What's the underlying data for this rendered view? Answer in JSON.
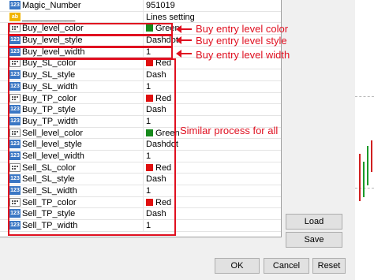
{
  "rows": [
    {
      "icon": "num",
      "name": "Magic_Number",
      "value": "951019"
    },
    {
      "icon": "ab",
      "name": "___________",
      "value": "Lines setting"
    },
    {
      "icon": "col",
      "name": "Buy_level_color",
      "value": "Green",
      "swatch": "#178a1c"
    },
    {
      "icon": "num",
      "name": "Buy_level_style",
      "value": "Dashdot"
    },
    {
      "icon": "num",
      "name": "Buy_level_width",
      "value": "1"
    },
    {
      "icon": "col",
      "name": "Buy_SL_color",
      "value": "Red",
      "swatch": "#e01010"
    },
    {
      "icon": "num",
      "name": "Buy_SL_style",
      "value": "Dash"
    },
    {
      "icon": "num",
      "name": "Buy_SL_width",
      "value": "1"
    },
    {
      "icon": "col",
      "name": "Buy_TP_color",
      "value": "Red",
      "swatch": "#e01010"
    },
    {
      "icon": "num",
      "name": "Buy_TP_style",
      "value": "Dash"
    },
    {
      "icon": "num",
      "name": "Buy_TP_width",
      "value": "1"
    },
    {
      "icon": "col",
      "name": "Sell_level_color",
      "value": "Green",
      "swatch": "#178a1c"
    },
    {
      "icon": "num",
      "name": "Sell_level_style",
      "value": "Dashdot"
    },
    {
      "icon": "num",
      "name": "Sell_level_width",
      "value": "1"
    },
    {
      "icon": "col",
      "name": "Sell_SL_color",
      "value": "Red",
      "swatch": "#e01010"
    },
    {
      "icon": "num",
      "name": "Sell_SL_style",
      "value": "Dash"
    },
    {
      "icon": "num",
      "name": "Sell_SL_width",
      "value": "1"
    },
    {
      "icon": "col",
      "name": "Sell_TP_color",
      "value": "Red",
      "swatch": "#e01010"
    },
    {
      "icon": "num",
      "name": "Sell_TP_style",
      "value": "Dash"
    },
    {
      "icon": "num",
      "name": "Sell_TP_width",
      "value": "1"
    }
  ],
  "icon_glyphs": {
    "num": "123",
    "ab": "ab",
    "col": ""
  },
  "annotations": {
    "buy_color": "Buy entry level color",
    "buy_style": "Buy entry level style",
    "buy_width": "Buy entry level width",
    "similar": "Similar process for all"
  },
  "buttons": {
    "load": "Load",
    "save": "Save",
    "ok": "OK",
    "cancel": "Cancel",
    "reset": "Reset"
  },
  "colors": {
    "highlight": "#e01020",
    "green": "#178a1c",
    "red": "#e01010"
  }
}
